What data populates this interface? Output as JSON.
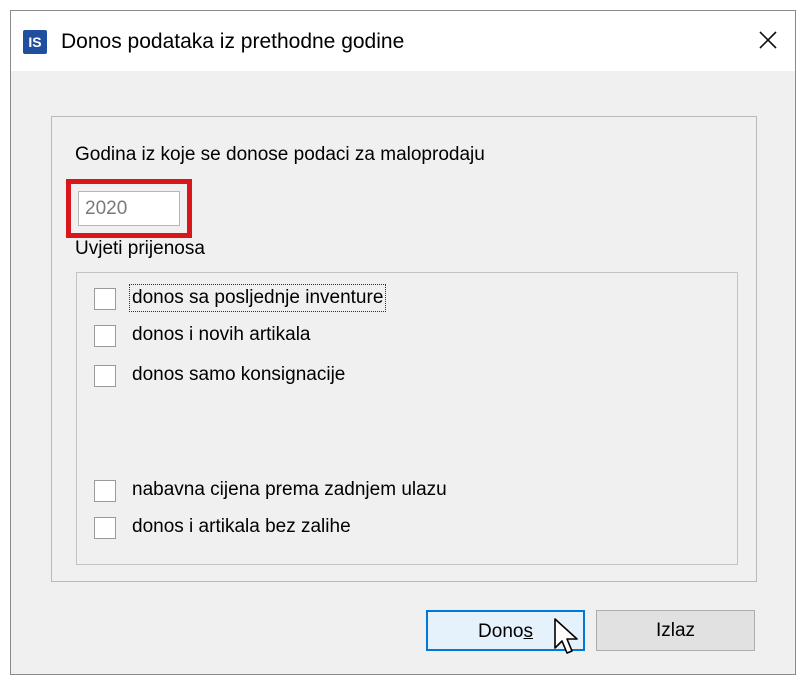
{
  "dialog": {
    "icon_text": "IS",
    "title": "Donos podataka iz prethodne godine",
    "close_icon": "close-icon"
  },
  "form": {
    "year_label": "Godina iz koje se donose podaci za maloprodaju",
    "year_value": "2020",
    "conditions_label": "Uvjeti prijenosa",
    "checkboxes": [
      {
        "label": "donos sa posljednje inventure",
        "checked": false,
        "focused": true
      },
      {
        "label": "donos i novih artikala",
        "checked": false
      },
      {
        "label": "donos samo konsignacije",
        "checked": false
      },
      {
        "label": "nabavna cijena prema zadnjem ulazu",
        "checked": false
      },
      {
        "label": "donos i artikala bez zalihe",
        "checked": false
      }
    ]
  },
  "buttons": {
    "donos_prefix": "Dono",
    "donos_mnemonic": "s",
    "exit": "Izlaz"
  },
  "colors": {
    "highlight": "#d8161b",
    "accent": "#0078d7",
    "app_icon": "#1f4f9e"
  }
}
